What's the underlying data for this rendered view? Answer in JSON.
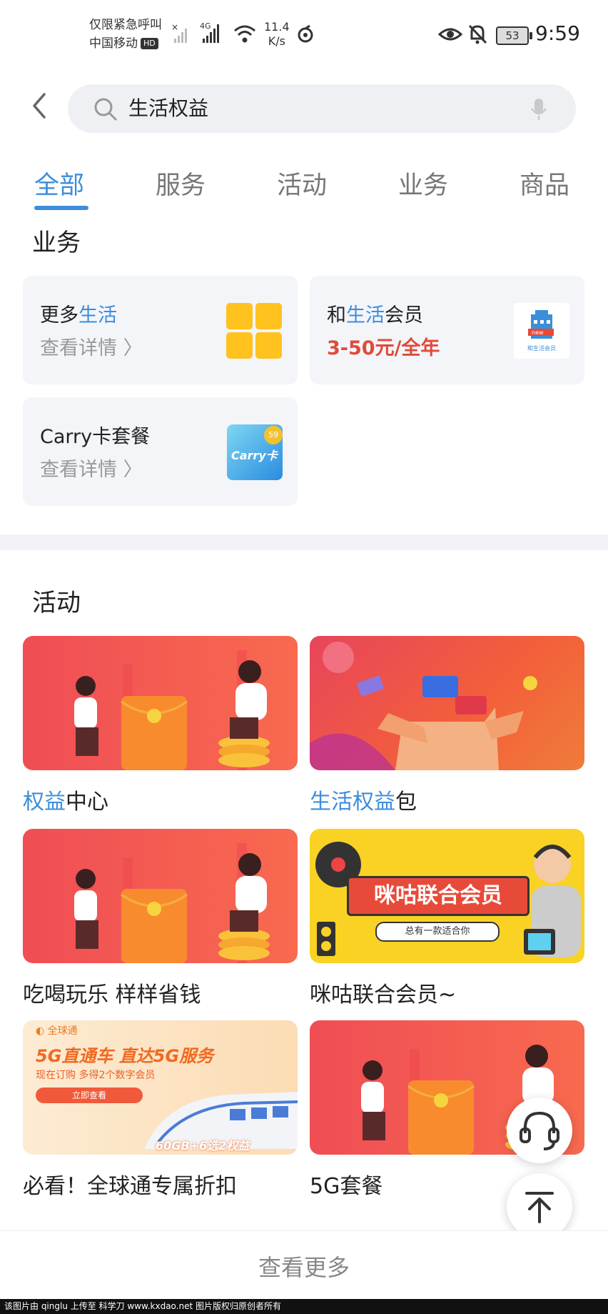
{
  "status_bar": {
    "carrier_line1": "仅限紧急呼叫",
    "carrier_line2": "中国移动",
    "hd": "HD",
    "network": "4G",
    "speed_value": "11.4",
    "speed_unit": "K/s",
    "battery": "53",
    "time": "9:59"
  },
  "search": {
    "query": "生活权益"
  },
  "tabs": [
    {
      "label": "全部",
      "active": true
    },
    {
      "label": "服务",
      "active": false
    },
    {
      "label": "活动",
      "active": false
    },
    {
      "label": "业务",
      "active": false
    },
    {
      "label": "商品",
      "active": false
    }
  ],
  "business": {
    "title": "业务",
    "cards": [
      {
        "title_pre": "更多",
        "title_hl": "生活",
        "title_post": "",
        "subtitle": "查看详情 〉"
      },
      {
        "title_pre": "和",
        "title_hl": "生活",
        "title_post": "会员",
        "price": "3-50元/全年",
        "thumb_label": "和生活会员",
        "thumb_badge": "new"
      },
      {
        "title_pre": "Carry卡套餐",
        "title_hl": "",
        "title_post": "",
        "subtitle": "查看详情 〉",
        "thumb_label": "Carry卡",
        "thumb_badge": "59"
      }
    ]
  },
  "activities": {
    "title": "活动",
    "items": [
      {
        "caption_hl": "权益",
        "caption_rest": "中心"
      },
      {
        "caption_hl": "生活权益",
        "caption_rest": "包"
      },
      {
        "caption_hl": "",
        "caption_rest": "吃喝玩乐 样样省钱"
      },
      {
        "caption_hl": "",
        "caption_rest": "咪咕联合会员~",
        "banner_title": "咪咕联合会员",
        "banner_sub": "总有一款适合你"
      },
      {
        "caption_hl": "",
        "caption_rest": "必看！全球通专属折扣",
        "banner_brand": "全球通",
        "banner_title": "5G直通车 直达5G服务",
        "banner_sub": "现在订购 多得2个数字会员",
        "banner_btn": "立即查看",
        "banner_tag": "60GB+6选2权益"
      },
      {
        "caption_hl": "",
        "caption_rest": "5G套餐"
      }
    ]
  },
  "more_label": "查看更多",
  "footer_text": "该图片由 qinglu 上传至 科学刀 www.kxdao.net 图片版权归原创者所有",
  "colors": {
    "accent": "#3d8ddb",
    "price": "#e04a3a"
  }
}
